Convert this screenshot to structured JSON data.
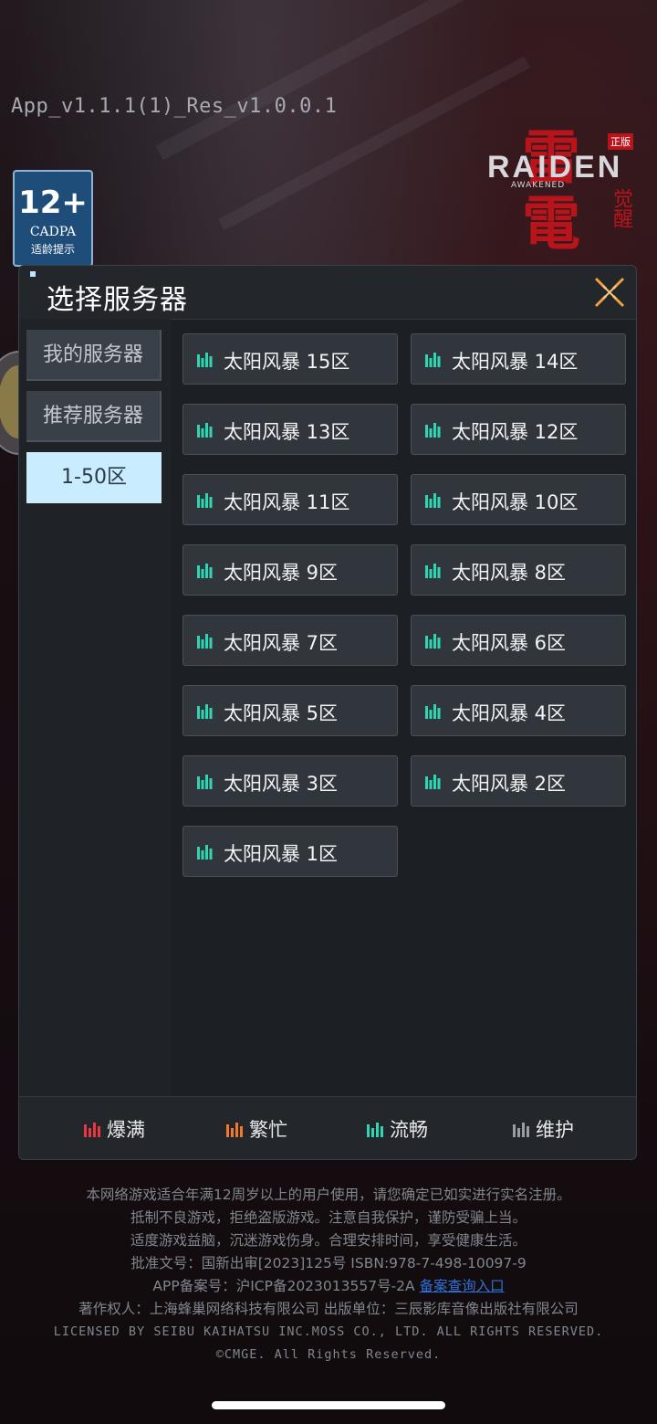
{
  "app": {
    "version_label": "App_v1.1.1(1)_Res_v1.0.0.1",
    "age_rating": {
      "number": "12+",
      "org": "CADPA",
      "tip": "适龄提示"
    },
    "logo": {
      "kanji_top": "雷",
      "kanji_bottom": "電",
      "word": "RAIDEN",
      "sub": "AWAKENED",
      "side": "觉醒",
      "tag": "正版"
    }
  },
  "dialog": {
    "title": "选择服务器",
    "close_icon": "close-x-icon",
    "sidebar": [
      {
        "label": "我的服务器",
        "active": false
      },
      {
        "label": "推荐服务器",
        "active": false
      },
      {
        "label": "1-50区",
        "active": true
      }
    ],
    "servers": [
      {
        "name": "太阳风暴 15区",
        "status": "smooth"
      },
      {
        "name": "太阳风暴 14区",
        "status": "smooth"
      },
      {
        "name": "太阳风暴 13区",
        "status": "smooth"
      },
      {
        "name": "太阳风暴 12区",
        "status": "smooth"
      },
      {
        "name": "太阳风暴 11区",
        "status": "smooth"
      },
      {
        "name": "太阳风暴 10区",
        "status": "smooth"
      },
      {
        "name": "太阳风暴 9区",
        "status": "smooth"
      },
      {
        "name": "太阳风暴 8区",
        "status": "smooth"
      },
      {
        "name": "太阳风暴 7区",
        "status": "smooth"
      },
      {
        "name": "太阳风暴 6区",
        "status": "smooth"
      },
      {
        "name": "太阳风暴 5区",
        "status": "smooth"
      },
      {
        "name": "太阳风暴 4区",
        "status": "smooth"
      },
      {
        "name": "太阳风暴 3区",
        "status": "smooth"
      },
      {
        "name": "太阳风暴 2区",
        "status": "smooth"
      },
      {
        "name": "太阳风暴 1区",
        "status": "smooth"
      }
    ],
    "legend": [
      {
        "label": "爆满",
        "color": "#e8383d"
      },
      {
        "label": "繁忙",
        "color": "#f07a2a"
      },
      {
        "label": "流畅",
        "color": "#2fd6b4"
      },
      {
        "label": "维护",
        "color": "#9a9ea4"
      }
    ]
  },
  "notice": {
    "line1": "本网络游戏适合年满12周岁以上的用户使用，请您确定已如实进行实名注册。",
    "line2": "抵制不良游戏，拒绝盗版游戏。注意自我保护，谨防受骗上当。",
    "line3": "适度游戏益脑，沉迷游戏伤身。合理安排时间，享受健康生活。",
    "line4": "批准文号：国新出审[2023]125号 ISBN:978-7-498-10097-9",
    "line5_prefix": "APP备案号：沪ICP备2023013557号-2A ",
    "line5_link": "备案查询入口",
    "line6": "著作权人：上海蜂巢网络科技有限公司 出版单位：三辰影库音像出版社有限公司",
    "line7": "LICENSED BY SEIBU KAIHATSU INC.MOSS CO., LTD. ALL RIGHTS RESERVED.",
    "line8": "©CMGE. All Rights Reserved."
  }
}
